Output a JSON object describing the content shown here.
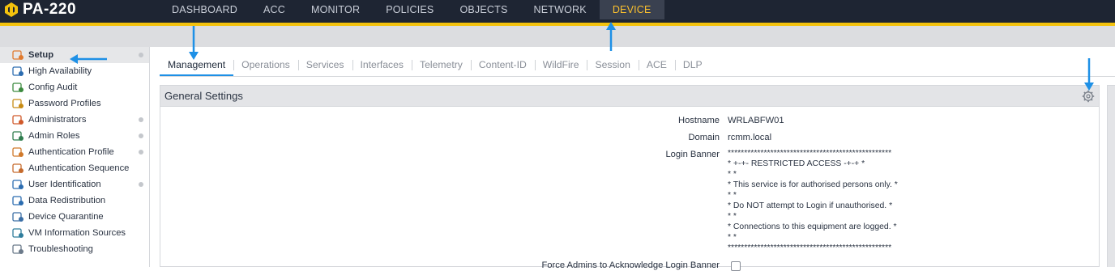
{
  "app": {
    "name": "PA-220"
  },
  "nav": {
    "items": [
      "DASHBOARD",
      "ACC",
      "MONITOR",
      "POLICIES",
      "OBJECTS",
      "NETWORK",
      "DEVICE"
    ],
    "active": "DEVICE"
  },
  "sidebar": {
    "items": [
      {
        "label": "Setup",
        "icon": "setup-icon",
        "active": true,
        "dot": true
      },
      {
        "label": "High Availability",
        "icon": "high-availability-icon",
        "dot": false
      },
      {
        "label": "Config Audit",
        "icon": "config-audit-icon",
        "dot": false
      },
      {
        "label": "Password Profiles",
        "icon": "password-profiles-icon",
        "dot": false
      },
      {
        "label": "Administrators",
        "icon": "administrators-icon",
        "dot": true
      },
      {
        "label": "Admin Roles",
        "icon": "admin-roles-icon",
        "dot": true
      },
      {
        "label": "Authentication Profile",
        "icon": "authentication-profile-icon",
        "dot": true
      },
      {
        "label": "Authentication Sequence",
        "icon": "authentication-sequence-icon",
        "dot": false
      },
      {
        "label": "User Identification",
        "icon": "user-identification-icon",
        "dot": true
      },
      {
        "label": "Data Redistribution",
        "icon": "data-redistribution-icon",
        "dot": false
      },
      {
        "label": "Device Quarantine",
        "icon": "device-quarantine-icon",
        "dot": false
      },
      {
        "label": "VM Information Sources",
        "icon": "vm-information-sources-icon",
        "dot": false
      },
      {
        "label": "Troubleshooting",
        "icon": "troubleshooting-icon",
        "dot": false
      }
    ]
  },
  "tabs": {
    "items": [
      "Management",
      "Operations",
      "Services",
      "Interfaces",
      "Telemetry",
      "Content-ID",
      "WildFire",
      "Session",
      "ACE",
      "DLP"
    ],
    "active": "Management"
  },
  "general_settings": {
    "title": "General Settings",
    "hostname_label": "Hostname",
    "hostname_value": "WRLABFW01",
    "domain_label": "Domain",
    "domain_value": "rcmm.local",
    "login_banner_label": "Login Banner",
    "login_banner_lines": [
      "**************************************************",
      "* +-+- RESTRICTED ACCESS -+-+ *",
      "* *",
      "* This service is for authorised persons only. *",
      "* *",
      "* Do NOT attempt to Login if unauthorised. *",
      "* *",
      "* Connections to this equipment are logged. *",
      "* *",
      "**************************************************"
    ],
    "force_ack_label": "Force Admins to Acknowledge Login Banner",
    "force_ack_checked": false
  },
  "colors": {
    "topbar": "#1e2533",
    "accent_gold": "#f4c20d",
    "active_nav_text": "#fbc02d",
    "tab_underline": "#1e90e6",
    "annotation_arrow": "#1e90e6"
  }
}
